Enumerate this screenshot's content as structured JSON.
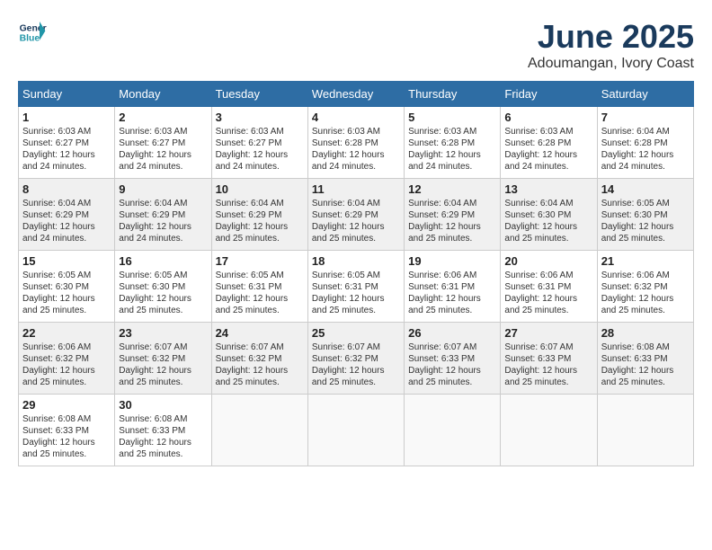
{
  "header": {
    "logo_line1": "General",
    "logo_line2": "Blue",
    "month": "June 2025",
    "location": "Adoumangan, Ivory Coast"
  },
  "weekdays": [
    "Sunday",
    "Monday",
    "Tuesday",
    "Wednesday",
    "Thursday",
    "Friday",
    "Saturday"
  ],
  "weeks": [
    [
      {
        "day": "1",
        "sunrise": "6:03 AM",
        "sunset": "6:27 PM",
        "daylight": "12 hours and 24 minutes."
      },
      {
        "day": "2",
        "sunrise": "6:03 AM",
        "sunset": "6:27 PM",
        "daylight": "12 hours and 24 minutes."
      },
      {
        "day": "3",
        "sunrise": "6:03 AM",
        "sunset": "6:27 PM",
        "daylight": "12 hours and 24 minutes."
      },
      {
        "day": "4",
        "sunrise": "6:03 AM",
        "sunset": "6:28 PM",
        "daylight": "12 hours and 24 minutes."
      },
      {
        "day": "5",
        "sunrise": "6:03 AM",
        "sunset": "6:28 PM",
        "daylight": "12 hours and 24 minutes."
      },
      {
        "day": "6",
        "sunrise": "6:03 AM",
        "sunset": "6:28 PM",
        "daylight": "12 hours and 24 minutes."
      },
      {
        "day": "7",
        "sunrise": "6:04 AM",
        "sunset": "6:28 PM",
        "daylight": "12 hours and 24 minutes."
      }
    ],
    [
      {
        "day": "8",
        "sunrise": "6:04 AM",
        "sunset": "6:29 PM",
        "daylight": "12 hours and 24 minutes."
      },
      {
        "day": "9",
        "sunrise": "6:04 AM",
        "sunset": "6:29 PM",
        "daylight": "12 hours and 24 minutes."
      },
      {
        "day": "10",
        "sunrise": "6:04 AM",
        "sunset": "6:29 PM",
        "daylight": "12 hours and 25 minutes."
      },
      {
        "day": "11",
        "sunrise": "6:04 AM",
        "sunset": "6:29 PM",
        "daylight": "12 hours and 25 minutes."
      },
      {
        "day": "12",
        "sunrise": "6:04 AM",
        "sunset": "6:29 PM",
        "daylight": "12 hours and 25 minutes."
      },
      {
        "day": "13",
        "sunrise": "6:04 AM",
        "sunset": "6:30 PM",
        "daylight": "12 hours and 25 minutes."
      },
      {
        "day": "14",
        "sunrise": "6:05 AM",
        "sunset": "6:30 PM",
        "daylight": "12 hours and 25 minutes."
      }
    ],
    [
      {
        "day": "15",
        "sunrise": "6:05 AM",
        "sunset": "6:30 PM",
        "daylight": "12 hours and 25 minutes."
      },
      {
        "day": "16",
        "sunrise": "6:05 AM",
        "sunset": "6:30 PM",
        "daylight": "12 hours and 25 minutes."
      },
      {
        "day": "17",
        "sunrise": "6:05 AM",
        "sunset": "6:31 PM",
        "daylight": "12 hours and 25 minutes."
      },
      {
        "day": "18",
        "sunrise": "6:05 AM",
        "sunset": "6:31 PM",
        "daylight": "12 hours and 25 minutes."
      },
      {
        "day": "19",
        "sunrise": "6:06 AM",
        "sunset": "6:31 PM",
        "daylight": "12 hours and 25 minutes."
      },
      {
        "day": "20",
        "sunrise": "6:06 AM",
        "sunset": "6:31 PM",
        "daylight": "12 hours and 25 minutes."
      },
      {
        "day": "21",
        "sunrise": "6:06 AM",
        "sunset": "6:32 PM",
        "daylight": "12 hours and 25 minutes."
      }
    ],
    [
      {
        "day": "22",
        "sunrise": "6:06 AM",
        "sunset": "6:32 PM",
        "daylight": "12 hours and 25 minutes."
      },
      {
        "day": "23",
        "sunrise": "6:07 AM",
        "sunset": "6:32 PM",
        "daylight": "12 hours and 25 minutes."
      },
      {
        "day": "24",
        "sunrise": "6:07 AM",
        "sunset": "6:32 PM",
        "daylight": "12 hours and 25 minutes."
      },
      {
        "day": "25",
        "sunrise": "6:07 AM",
        "sunset": "6:32 PM",
        "daylight": "12 hours and 25 minutes."
      },
      {
        "day": "26",
        "sunrise": "6:07 AM",
        "sunset": "6:33 PM",
        "daylight": "12 hours and 25 minutes."
      },
      {
        "day": "27",
        "sunrise": "6:07 AM",
        "sunset": "6:33 PM",
        "daylight": "12 hours and 25 minutes."
      },
      {
        "day": "28",
        "sunrise": "6:08 AM",
        "sunset": "6:33 PM",
        "daylight": "12 hours and 25 minutes."
      }
    ],
    [
      {
        "day": "29",
        "sunrise": "6:08 AM",
        "sunset": "6:33 PM",
        "daylight": "12 hours and 25 minutes."
      },
      {
        "day": "30",
        "sunrise": "6:08 AM",
        "sunset": "6:33 PM",
        "daylight": "12 hours and 25 minutes."
      },
      null,
      null,
      null,
      null,
      null
    ]
  ]
}
